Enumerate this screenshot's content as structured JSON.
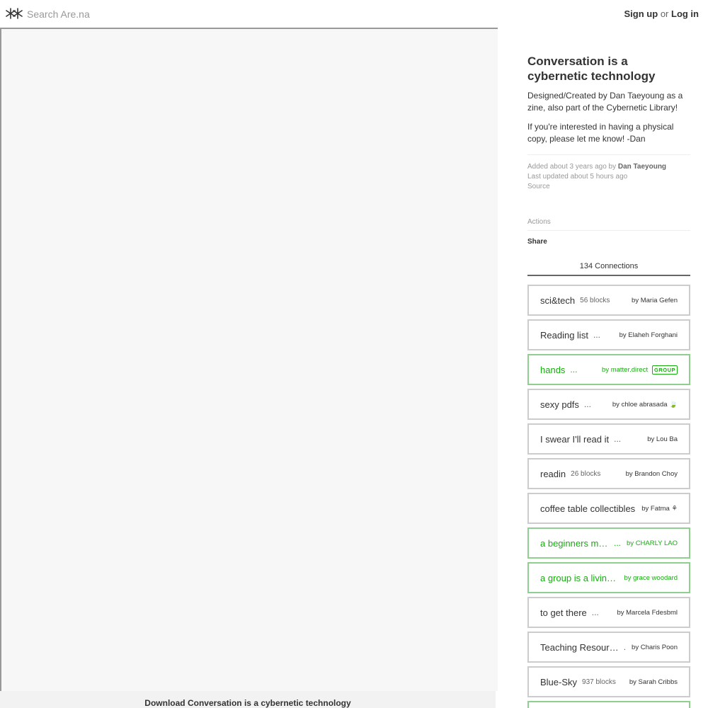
{
  "header": {
    "search_placeholder": "Search Are.na",
    "signup_label": "Sign up",
    "or_label": "or",
    "login_label": "Log in",
    "logo_icon": "arena-asterisk-icon"
  },
  "viewer": {
    "download_label": "Download Conversation is a cybernetic technology"
  },
  "block": {
    "title": "Conversation is a cybernetic technology",
    "description": [
      "Designed/Created by Dan Taeyoung as a zine, also part of the Cybernetic Library!",
      "If you're interested in having a physical copy, please let me know! -Dan"
    ],
    "added_prefix": "Added about 3 years ago by",
    "added_by": "Dan Taeyoung",
    "last_updated": "Last updated about 5 hours ago",
    "source_label": "Source"
  },
  "actions": {
    "label": "Actions",
    "share_label": "Share"
  },
  "connections": {
    "tab_label": "134 Connections",
    "items": [
      {
        "name": "sci&tech",
        "count": "56 blocks",
        "owner": "by Maria Gefen",
        "green": false
      },
      {
        "name": "Reading list",
        "dots": "...",
        "owner": "by Elaheh Forghani",
        "green": false
      },
      {
        "name": "hands",
        "dots": "...",
        "owner": "by matter.direct",
        "badge": "GROUP",
        "green": true
      },
      {
        "name": "sexy pdfs",
        "dots": "...",
        "owner": "by chloe abrasada 🍃",
        "green": false
      },
      {
        "name": "I swear I'll read it",
        "dots": "...",
        "owner": "by Lou Ba",
        "green": false
      },
      {
        "name": "readin",
        "count": "26 blocks",
        "owner": "by Brandon Choy",
        "green": false
      },
      {
        "name": "coffee table collectibles",
        "owner": "by Fatma ⚘",
        "green": false
      },
      {
        "name": "a beginners mind",
        "dots": "...",
        "owner": "by CHARLY LAO",
        "green": true
      },
      {
        "name": "a group is a living organism",
        "owner": "by grace woodard",
        "green": true
      },
      {
        "name": "to get there",
        "dots": "...",
        "owner": "by Marcela Fdesbml",
        "green": false
      },
      {
        "name": "Teaching Resources",
        "dots": ".",
        "owner": "by Charis Poon",
        "green": false
      },
      {
        "name": "Blue-Sky",
        "count": "937 blocks",
        "owner": "by Sarah Cribbs",
        "green": false
      }
    ]
  }
}
